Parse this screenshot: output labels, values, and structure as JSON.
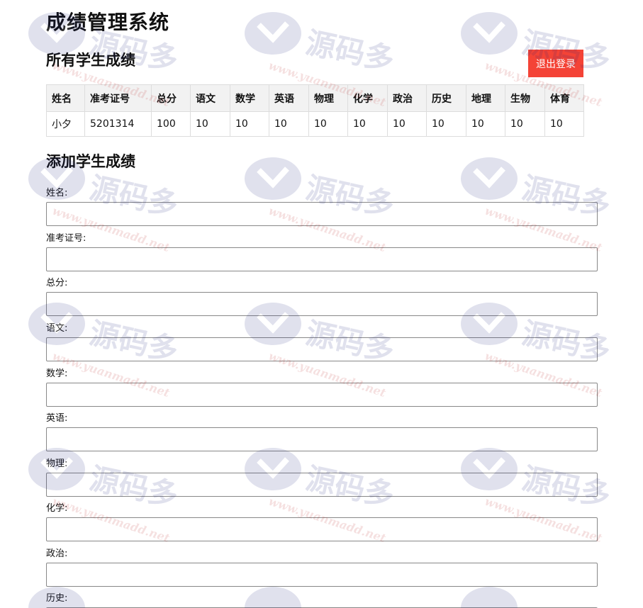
{
  "app": {
    "title": "成绩管理系统"
  },
  "scores": {
    "heading": "所有学生成绩",
    "logout_label": "退出登录",
    "columns": [
      "姓名",
      "准考证号",
      "总分",
      "语文",
      "数学",
      "英语",
      "物理",
      "化学",
      "政治",
      "历史",
      "地理",
      "生物",
      "体育"
    ],
    "rows": [
      [
        "小夕",
        "5201314",
        "100",
        "10",
        "10",
        "10",
        "10",
        "10",
        "10",
        "10",
        "10",
        "10",
        "10"
      ]
    ]
  },
  "add_form": {
    "heading": "添加学生成绩",
    "fields": [
      {
        "label": "姓名:",
        "value": ""
      },
      {
        "label": "准考证号:",
        "value": ""
      },
      {
        "label": "总分:",
        "value": ""
      },
      {
        "label": "语文:",
        "value": ""
      },
      {
        "label": "数学:",
        "value": ""
      },
      {
        "label": "英语:",
        "value": ""
      },
      {
        "label": "物理:",
        "value": ""
      },
      {
        "label": "化学:",
        "value": ""
      },
      {
        "label": "政治:",
        "value": ""
      },
      {
        "label": "历史:",
        "value": ""
      }
    ]
  },
  "watermark": {
    "brand": "源码多",
    "url": "www.yuanmadd.net",
    "color": "#1a237e"
  },
  "colors": {
    "logout_bg": "#f44336",
    "table_header_bg": "#f2f2f2",
    "border": "#dddddd"
  }
}
